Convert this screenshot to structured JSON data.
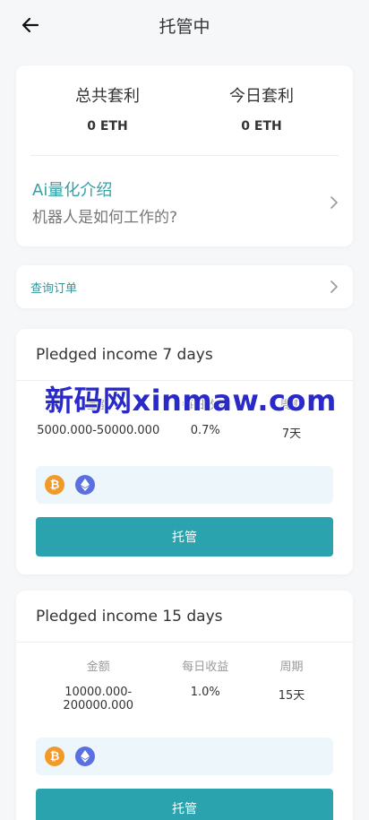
{
  "header": {
    "title": "托管中"
  },
  "stats": {
    "total_label": "总共套利",
    "total_value": "0 ETH",
    "today_label": "今日套利",
    "today_value": "0 ETH"
  },
  "intro": {
    "title": "Ai量化介绍",
    "subtitle": "机器人是如何工作的?"
  },
  "query": {
    "label": "查询订单"
  },
  "plans": [
    {
      "title": "Pledged income 7 days",
      "col_amount": "金额",
      "col_rate": "每日收益",
      "col_period": "周期",
      "amount": "5000.000-50000.000",
      "rate": "0.7%",
      "period": "7天",
      "button": "托管"
    },
    {
      "title": "Pledged income 15 days",
      "col_amount": "金额",
      "col_rate": "每日收益",
      "col_period": "周期",
      "amount": "10000.000-200000.000",
      "rate": "1.0%",
      "period": "15天",
      "button": "托管"
    }
  ],
  "coins": [
    "btc-icon",
    "eth-icon"
  ],
  "watermark": "新码网xinmaw.com",
  "colors": {
    "accent": "#2aa3ae",
    "link": "#35a1a5",
    "btc": "#f29a29",
    "eth": "#5a6fe0",
    "coin_bar": "#edf6fb"
  }
}
